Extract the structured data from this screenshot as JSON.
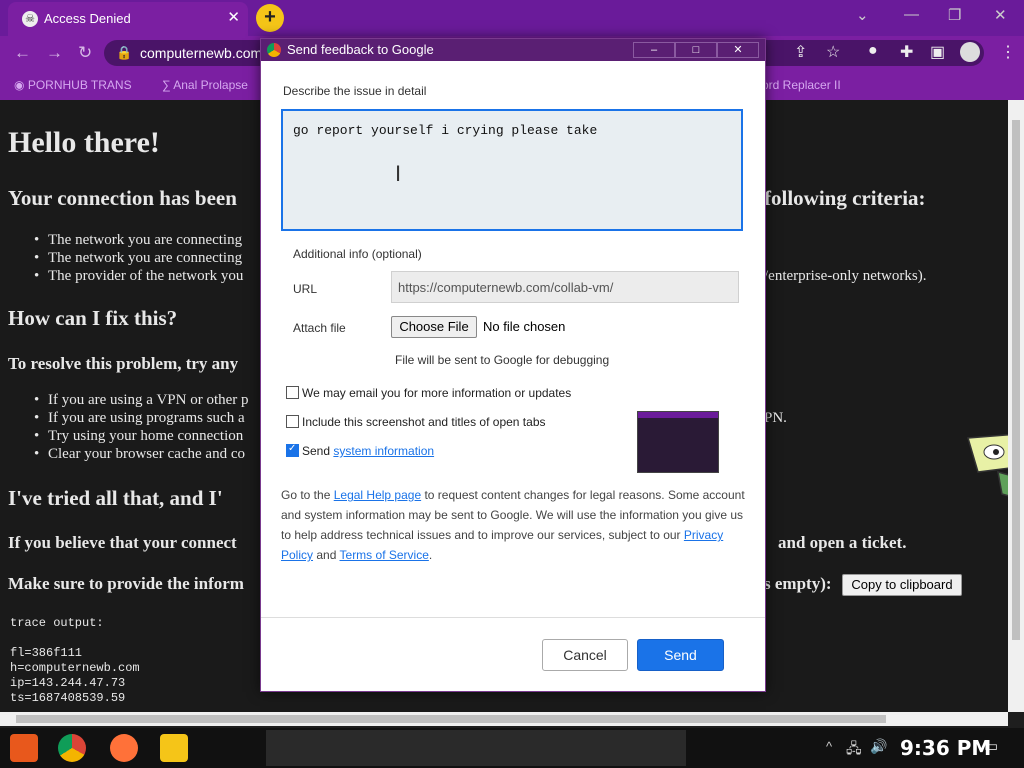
{
  "browser": {
    "tab_title": "Access Denied",
    "tab_close": "✕",
    "new_tab": "+",
    "address": "computernewb.com",
    "bookmarks": [
      {
        "label": "PORNHUB TRANS"
      },
      {
        "label": "Anal Prolapse"
      },
      {
        "label": "ord Replacer II"
      }
    ]
  },
  "page": {
    "heading": "Hello there!",
    "sub1": "Your connection has been",
    "sub1_right": "following criteria:",
    "criteria": [
      "The network you are connecting",
      "The network you are connecting",
      "The provider of the network you"
    ],
    "criteria_right": "/enterprise-only networks).",
    "fix_heading": "How can I fix this?",
    "resolve": "To resolve this problem, try any",
    "fixes": [
      "If you are using a VPN or other p",
      "If you are using programs such a",
      "Try using your home connection",
      "Clear your browser cache and co"
    ],
    "fix_right": "PN.",
    "tried": "I've tried all that, and I'",
    "believe": "If you believe that your connect",
    "believe_right": "and open a ticket.",
    "provide": "Make sure to provide the inform",
    "provide_right": "s empty):",
    "copy_button": "Copy to clipboard",
    "trace_label": "trace output:",
    "trace": [
      "fl=386f111",
      "h=computernewb.com",
      "ip=143.244.47.73",
      "ts=1687408539.59"
    ]
  },
  "dialog": {
    "title": "Send feedback to Google",
    "describe_label": "Describe the issue in detail",
    "issue_text": "go report yourself i crying please take",
    "additional_label": "Additional info (optional)",
    "url_label": "URL",
    "url_value": "https://computernewb.com/collab-vm/",
    "attach_label": "Attach file",
    "choose_file": "Choose File",
    "no_file": "No file chosen",
    "debug_note": "File will be sent to Google for debugging",
    "email_option": "We may email you for more information or updates",
    "screenshot_option": "Include this screenshot and titles of open tabs",
    "send_prefix": "Send",
    "system_info_link": "system information",
    "legal_1": "Go to the",
    "legal_link": "Legal Help page",
    "legal_2": "to request content changes for legal reasons. Some account and system information may be sent to Google. We will use the information you give us to help address technical issues and to improve our services, subject to our",
    "privacy_link": "Privacy Policy",
    "legal_3": "and",
    "terms_link": "Terms of Service",
    "legal_4": ".",
    "cancel": "Cancel",
    "send": "Send"
  },
  "taskbar": {
    "time": "9:36 PM"
  },
  "colors": {
    "accent": "#1a73e8",
    "chrome_purple": "#7b1fa2"
  }
}
